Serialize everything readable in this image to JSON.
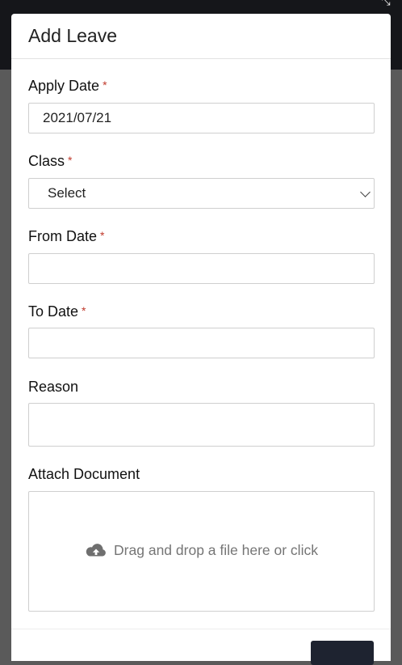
{
  "modal": {
    "title": "Add Leave"
  },
  "form": {
    "apply_date": {
      "label": "Apply Date",
      "required_mark": "*",
      "value": "2021/07/21"
    },
    "class": {
      "label": "Class",
      "required_mark": "*",
      "selected": "Select"
    },
    "from_date": {
      "label": "From Date",
      "required_mark": "*",
      "value": ""
    },
    "to_date": {
      "label": "To Date",
      "required_mark": "*",
      "value": ""
    },
    "reason": {
      "label": "Reason",
      "value": ""
    },
    "attach_document": {
      "label": "Attach Document",
      "dropzone_text": "Drag and drop a file here or click",
      "icon": "cloud-upload-icon"
    }
  },
  "colors": {
    "required": "#c0392b",
    "overlay": "#5a5a5a",
    "topbar": "#15161a",
    "footer_button": "#1e2330"
  }
}
